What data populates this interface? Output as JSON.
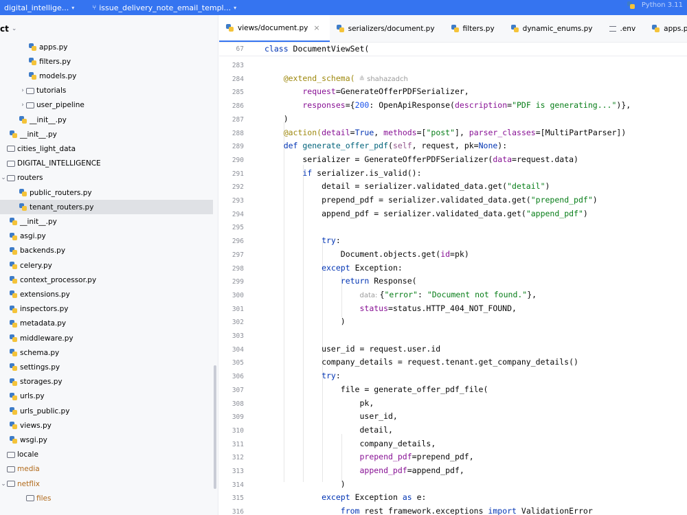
{
  "topbar": {
    "project": "digital_intellige...",
    "branch": "issue_delivery_note_email_templ...",
    "right_text": "Python 3.11"
  },
  "sidebar": {
    "title": "ct",
    "items": [
      {
        "label": "apps.py",
        "type": "py",
        "indent": 3,
        "expanded": null
      },
      {
        "label": "filters.py",
        "type": "py",
        "indent": 3,
        "expanded": null
      },
      {
        "label": "models.py",
        "type": "py",
        "indent": 3,
        "expanded": null
      },
      {
        "label": "tutorials",
        "type": "pkg",
        "indent": 2,
        "expanded": false
      },
      {
        "label": "user_pipeline",
        "type": "folder",
        "indent": 2,
        "expanded": false
      },
      {
        "label": "__init__.py",
        "type": "py",
        "indent": 2,
        "expanded": null
      },
      {
        "label": "__init__.py",
        "type": "py",
        "indent": 1,
        "expanded": null
      },
      {
        "label": "cities_light_data",
        "type": "folder",
        "indent": 0,
        "expanded": null
      },
      {
        "label": "DIGITAL_INTELLIGENCE",
        "type": "pkg",
        "indent": 0,
        "expanded": null
      },
      {
        "label": "routers",
        "type": "folder",
        "indent": 0,
        "expanded": true
      },
      {
        "label": "public_routers.py",
        "type": "py",
        "indent": 2,
        "expanded": null
      },
      {
        "label": "tenant_routers.py",
        "type": "py",
        "indent": 2,
        "expanded": null,
        "selected": true
      },
      {
        "label": "__init__.py",
        "type": "py",
        "indent": 1,
        "expanded": null
      },
      {
        "label": "asgi.py",
        "type": "py",
        "indent": 1,
        "expanded": null
      },
      {
        "label": "backends.py",
        "type": "py",
        "indent": 1,
        "expanded": null
      },
      {
        "label": "celery.py",
        "type": "py",
        "indent": 1,
        "expanded": null
      },
      {
        "label": "context_processor.py",
        "type": "py",
        "indent": 1,
        "expanded": null
      },
      {
        "label": "extensions.py",
        "type": "py",
        "indent": 1,
        "expanded": null
      },
      {
        "label": "inspectors.py",
        "type": "py",
        "indent": 1,
        "expanded": null
      },
      {
        "label": "metadata.py",
        "type": "py",
        "indent": 1,
        "expanded": null
      },
      {
        "label": "middleware.py",
        "type": "py",
        "indent": 1,
        "expanded": null
      },
      {
        "label": "schema.py",
        "type": "py",
        "indent": 1,
        "expanded": null
      },
      {
        "label": "settings.py",
        "type": "py",
        "indent": 1,
        "expanded": null
      },
      {
        "label": "storages.py",
        "type": "py",
        "indent": 1,
        "expanded": null
      },
      {
        "label": "urls.py",
        "type": "py",
        "indent": 1,
        "expanded": null
      },
      {
        "label": "urls_public.py",
        "type": "py",
        "indent": 1,
        "expanded": null
      },
      {
        "label": "views.py",
        "type": "py",
        "indent": 1,
        "expanded": null
      },
      {
        "label": "wsgi.py",
        "type": "py",
        "indent": 1,
        "expanded": null
      },
      {
        "label": "locale",
        "type": "folder",
        "indent": 0,
        "expanded": null
      },
      {
        "label": "media",
        "type": "folder",
        "indent": 0,
        "expanded": null,
        "orange": true
      },
      {
        "label": "netflix",
        "type": "folder",
        "indent": 0,
        "expanded": true,
        "orange": true
      },
      {
        "label": "files",
        "type": "folder",
        "indent": 2,
        "expanded": null,
        "orange": true
      }
    ]
  },
  "tabs": [
    {
      "label": "views/document.py",
      "active": true,
      "icon": "py",
      "close": "×"
    },
    {
      "label": "serializers/document.py",
      "active": false,
      "icon": "py"
    },
    {
      "label": "filters.py",
      "active": false,
      "icon": "py"
    },
    {
      "label": "dynamic_enums.py",
      "active": false,
      "icon": "py"
    },
    {
      "label": ".env",
      "active": false,
      "icon": "env"
    },
    {
      "label": "apps.py",
      "active": false,
      "icon": "py"
    }
  ],
  "editor": {
    "sticky": {
      "line": "67",
      "tokens": [
        [
          "kw",
          "class "
        ],
        [
          "cls",
          "DocumentViewSet("
        ]
      ]
    },
    "lines": [
      {
        "n": "283",
        "tokens": []
      },
      {
        "n": "284",
        "tokens": [
          [
            "dec",
            "    @extend_schema("
          ]
        ],
        "author": "shahazadch"
      },
      {
        "n": "285",
        "tokens": [
          [
            "prm",
            "        request"
          ],
          [
            "",
            "=GenerateOfferPDFSerializer,"
          ]
        ]
      },
      {
        "n": "286",
        "tokens": [
          [
            "prm",
            "        responses"
          ],
          [
            "",
            "={"
          ],
          [
            "num",
            "200"
          ],
          [
            "",
            ": OpenApiResponse("
          ],
          [
            "prm",
            "description"
          ],
          [
            "",
            "="
          ],
          [
            "str",
            "\"PDF is generating...\""
          ],
          [
            "",
            ")},"
          ]
        ]
      },
      {
        "n": "287",
        "tokens": [
          [
            "",
            "    )"
          ]
        ]
      },
      {
        "n": "288",
        "tokens": [
          [
            "dec",
            "    @action("
          ],
          [
            "prm",
            "detail"
          ],
          [
            "",
            "="
          ],
          [
            "kw",
            "True"
          ],
          [
            "",
            ", "
          ],
          [
            "prm",
            "methods"
          ],
          [
            "",
            "=["
          ],
          [
            "str",
            "\"post\""
          ],
          [
            "",
            "], "
          ],
          [
            "prm",
            "parser_classes"
          ],
          [
            "",
            "=[MultiPartParser])"
          ]
        ]
      },
      {
        "n": "289",
        "tokens": [
          [
            "kw",
            "    def "
          ],
          [
            "fn",
            "generate_offer_pdf"
          ],
          [
            "",
            "("
          ],
          [
            "slf",
            "self"
          ],
          [
            "",
            ", request, pk="
          ],
          [
            "kw",
            "None"
          ],
          [
            "",
            "):"
          ]
        ]
      },
      {
        "n": "290",
        "tokens": [
          [
            "",
            "        serializer = GenerateOfferPDFSerializer("
          ],
          [
            "prm",
            "data"
          ],
          [
            "",
            "=request.data)"
          ]
        ]
      },
      {
        "n": "291",
        "tokens": [
          [
            "kw",
            "        if "
          ],
          [
            "",
            "serializer.is_valid():"
          ]
        ]
      },
      {
        "n": "292",
        "tokens": [
          [
            "",
            "            detail = serializer.validated_data.get("
          ],
          [
            "str",
            "\"detail\""
          ],
          [
            "",
            ")"
          ]
        ]
      },
      {
        "n": "293",
        "tokens": [
          [
            "",
            "            prepend_pdf = serializer.validated_data.get("
          ],
          [
            "str",
            "\"prepend_pdf\""
          ],
          [
            "",
            ")"
          ]
        ]
      },
      {
        "n": "294",
        "tokens": [
          [
            "",
            "            append_pdf = serializer.validated_data.get("
          ],
          [
            "str",
            "\"append_pdf\""
          ],
          [
            "",
            ")"
          ]
        ]
      },
      {
        "n": "295",
        "tokens": []
      },
      {
        "n": "296",
        "tokens": [
          [
            "kw",
            "            try"
          ],
          [
            "",
            ":"
          ]
        ]
      },
      {
        "n": "297",
        "tokens": [
          [
            "",
            "                Document.objects.get("
          ],
          [
            "prm",
            "id"
          ],
          [
            "",
            "=pk)"
          ]
        ]
      },
      {
        "n": "298",
        "tokens": [
          [
            "kw",
            "            except "
          ],
          [
            "",
            "Exception:"
          ]
        ]
      },
      {
        "n": "299",
        "tokens": [
          [
            "kw",
            "                return "
          ],
          [
            "",
            "Response("
          ]
        ]
      },
      {
        "n": "300",
        "tokens": [
          [
            "",
            "                    "
          ],
          [
            "hint",
            "data: "
          ],
          [
            "",
            "{"
          ],
          [
            "str",
            "\"error\""
          ],
          [
            "",
            ": "
          ],
          [
            "str",
            "\"Document not found.\""
          ],
          [
            "",
            "},"
          ]
        ]
      },
      {
        "n": "301",
        "tokens": [
          [
            "prm",
            "                    status"
          ],
          [
            "",
            "=status.HTTP_404_NOT_FOUND,"
          ]
        ]
      },
      {
        "n": "302",
        "tokens": [
          [
            "",
            "                )"
          ]
        ]
      },
      {
        "n": "303",
        "tokens": []
      },
      {
        "n": "304",
        "tokens": [
          [
            "",
            "            user_id = request.user.id"
          ]
        ]
      },
      {
        "n": "305",
        "tokens": [
          [
            "",
            "            company_details = request.tenant.get_company_details()"
          ]
        ]
      },
      {
        "n": "306",
        "tokens": [
          [
            "kw",
            "            try"
          ],
          [
            "",
            ":"
          ]
        ]
      },
      {
        "n": "307",
        "tokens": [
          [
            "",
            "                file = generate_offer_pdf_file("
          ]
        ]
      },
      {
        "n": "308",
        "tokens": [
          [
            "",
            "                    pk,"
          ]
        ]
      },
      {
        "n": "309",
        "tokens": [
          [
            "",
            "                    user_id,"
          ]
        ]
      },
      {
        "n": "310",
        "tokens": [
          [
            "",
            "                    detail,"
          ]
        ]
      },
      {
        "n": "311",
        "tokens": [
          [
            "",
            "                    company_details,"
          ]
        ]
      },
      {
        "n": "312",
        "tokens": [
          [
            "prm",
            "                    prepend_pdf"
          ],
          [
            "",
            "=prepend_pdf,"
          ]
        ]
      },
      {
        "n": "313",
        "tokens": [
          [
            "prm",
            "                    append_pdf"
          ],
          [
            "",
            "=append_pdf,"
          ]
        ]
      },
      {
        "n": "314",
        "tokens": [
          [
            "",
            "                )"
          ]
        ]
      },
      {
        "n": "315",
        "tokens": [
          [
            "kw",
            "            except "
          ],
          [
            "",
            "Exception "
          ],
          [
            "kw",
            "as "
          ],
          [
            "",
            "e:"
          ]
        ]
      },
      {
        "n": "316",
        "tokens": [
          [
            "kw",
            "                from "
          ],
          [
            "",
            "rest_framework.exceptions "
          ],
          [
            "kw",
            "import "
          ],
          [
            "",
            "ValidationError"
          ]
        ]
      }
    ]
  }
}
